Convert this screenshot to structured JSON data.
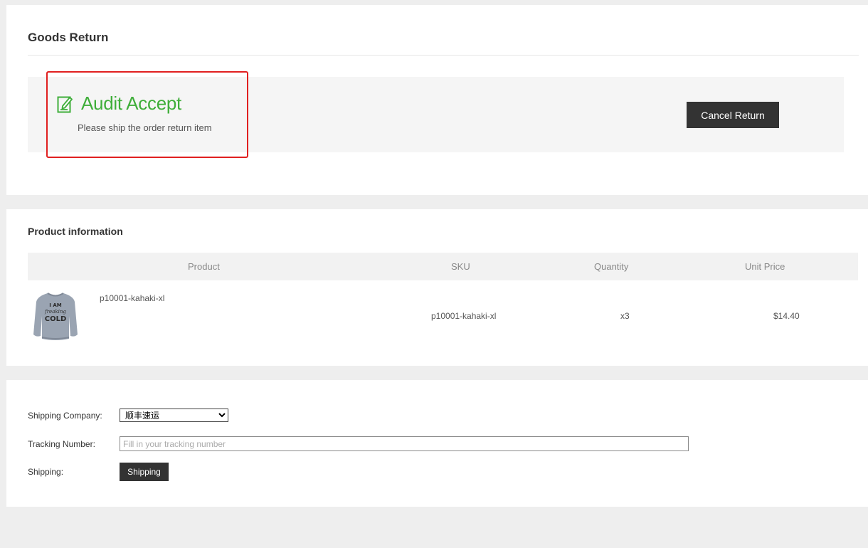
{
  "goods_return": {
    "title": "Goods Return",
    "status": {
      "icon": "edit-icon",
      "title": "Audit Accept",
      "subtitle": "Please ship the order return item",
      "color": "#3fae3a"
    },
    "cancel_label": "Cancel Return"
  },
  "product_info": {
    "title": "Product information",
    "columns": [
      "Product",
      "SKU",
      "Quantity",
      "Unit Price"
    ],
    "rows": [
      {
        "image": "sweatshirt-image",
        "image_text": [
          "I AM",
          "freaking",
          "COLD"
        ],
        "name": "p10001-kahaki-xl",
        "sku": "p10001-kahaki-xl",
        "quantity": "x3",
        "unit_price": "$14.40"
      }
    ]
  },
  "shipping_form": {
    "company_label": "Shipping Company:",
    "company_selected": "顺丰速运",
    "tracking_label": "Tracking Number:",
    "tracking_placeholder": "Fill in your tracking number",
    "shipping_label": "Shipping:",
    "ship_button_label": "Shipping"
  }
}
